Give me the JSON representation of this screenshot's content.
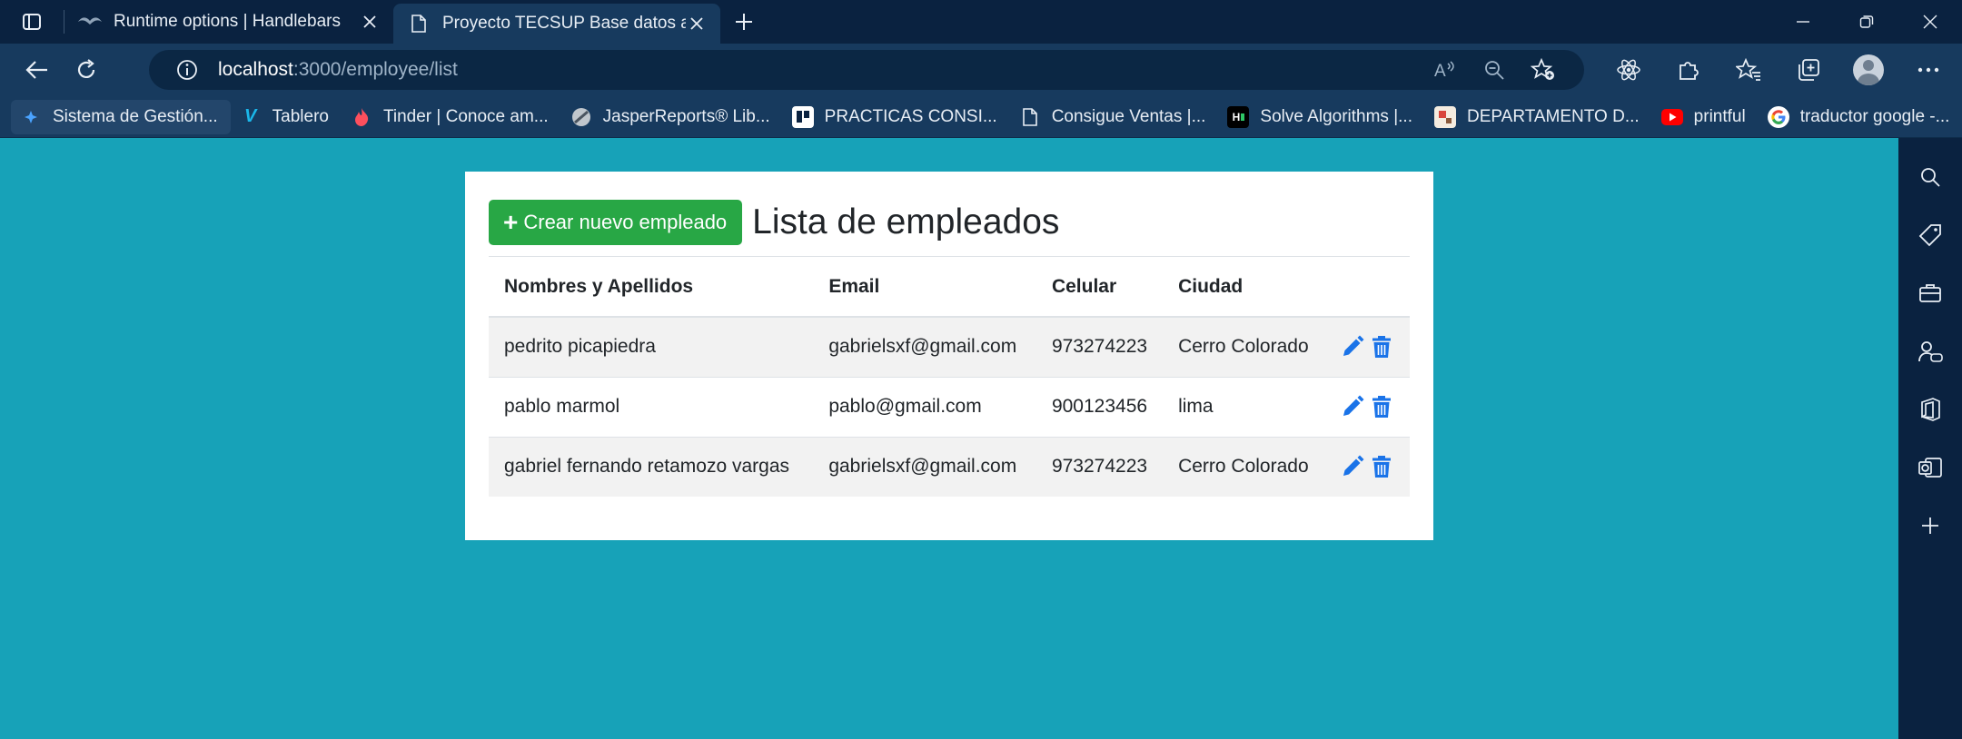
{
  "browser": {
    "tabs": [
      {
        "title": "Runtime options | Handlebars",
        "icon": "handlebars-icon",
        "active": false
      },
      {
        "title": "Proyecto TECSUP Base datos ava",
        "icon": "page-icon",
        "active": true
      }
    ],
    "address": {
      "host": "localhost",
      "rest": ":3000/employee/list"
    },
    "bookmarks": [
      {
        "label": "Sistema de Gestión...",
        "icon": "bookmark-sistema-icon"
      },
      {
        "label": "Tablero",
        "icon": "vimeo-icon"
      },
      {
        "label": "Tinder | Conoce am...",
        "icon": "tinder-flame-icon"
      },
      {
        "label": "JasperReports® Lib...",
        "icon": "jasper-icon"
      },
      {
        "label": "PRACTICAS CONSI...",
        "icon": "trello-icon"
      },
      {
        "label": "Consigue Ventas |...",
        "icon": "page-icon"
      },
      {
        "label": "Solve Algorithms |...",
        "icon": "hackerrank-icon"
      },
      {
        "label": "DEPARTAMENTO D...",
        "icon": "department-icon"
      },
      {
        "label": "printful",
        "icon": "youtube-icon"
      },
      {
        "label": "traductor google -...",
        "icon": "google-icon"
      }
    ]
  },
  "page": {
    "create_button": "Crear nuevo empleado",
    "title": "Lista de empleados",
    "columns": [
      "Nombres y Apellidos",
      "Email",
      "Celular",
      "Ciudad"
    ],
    "employees": [
      {
        "name": "pedrito picapiedra",
        "email": "gabrielsxf@gmail.com",
        "phone": "973274223",
        "city": "Cerro Colorado"
      },
      {
        "name": "pablo marmol",
        "email": "pablo@gmail.com",
        "phone": "900123456",
        "city": "lima"
      },
      {
        "name": "gabriel fernando retamozo vargas",
        "email": "gabrielsxf@gmail.com",
        "phone": "973274223",
        "city": "Cerro Colorado"
      }
    ]
  },
  "colors": {
    "page_background": "#17a2b8",
    "create_button": "#28a745",
    "action_icons": "#1a73e8",
    "browser_chrome": "#173a5e"
  }
}
